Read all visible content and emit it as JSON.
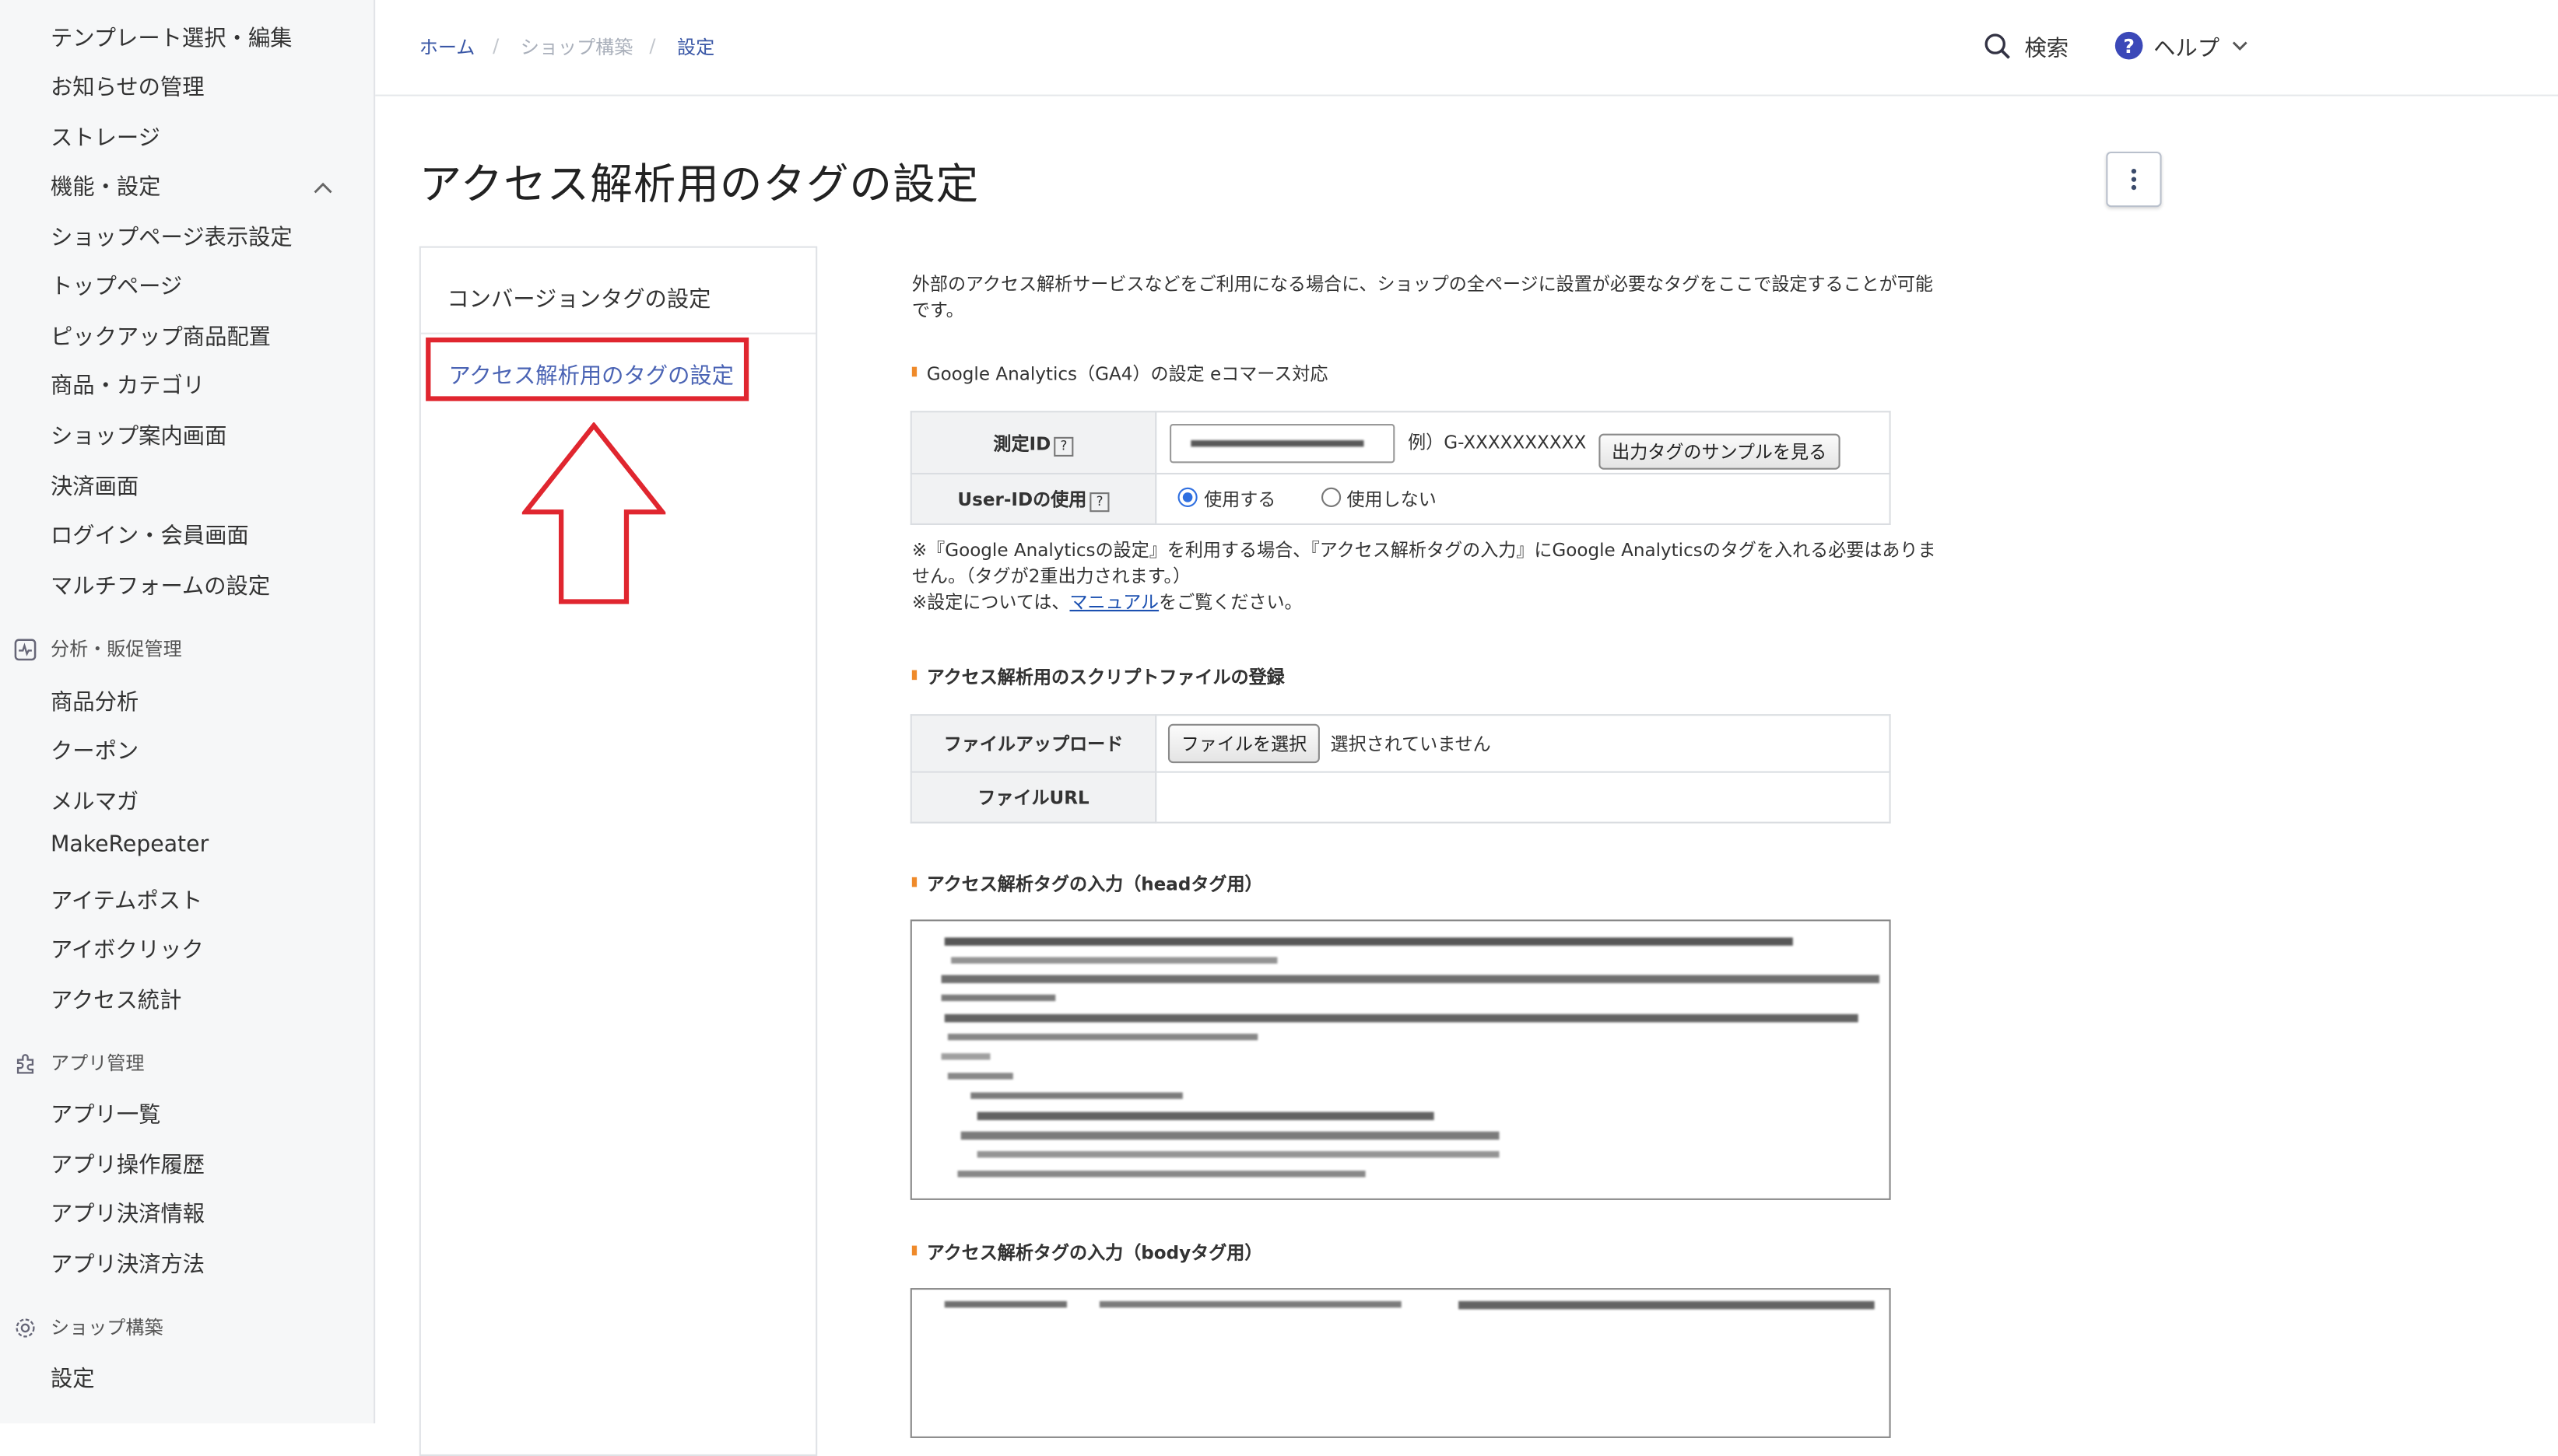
{
  "sidebar": {
    "items_top": [
      "テンプレート選択・編集",
      "お知らせの管理",
      "ストレージ"
    ],
    "group_features": "機能・設定",
    "features_items": [
      "ショップページ表示設定",
      "トップページ",
      "ピックアップ商品配置",
      "商品・カテゴリ",
      "ショップ案内画面",
      "決済画面",
      "ログイン・会員画面",
      "マルチフォームの設定"
    ],
    "section_analytics": "分析・販促管理",
    "analytics_items": [
      "商品分析",
      "クーポン",
      "メルマガ",
      "MakeRepeater",
      "アイテムポスト",
      "アイボクリック",
      "アクセス統計"
    ],
    "section_apps": "アプリ管理",
    "apps_items": [
      "アプリ一覧",
      "アプリ操作履歴",
      "アプリ決済情報",
      "アプリ決済方法"
    ],
    "section_shop": "ショップ構築",
    "shop_items": [
      "設定"
    ]
  },
  "header": {
    "breadcrumb": {
      "home": "ホーム",
      "shop": "ショップ構築",
      "settings": "設定",
      "sep": "/"
    },
    "search_label": "検索",
    "help_label": "ヘルプ"
  },
  "page": {
    "title": "アクセス解析用のタグの設定"
  },
  "subnav": {
    "conversion": "コンバージョンタグの設定",
    "access": "アクセス解析用のタグの設定"
  },
  "main": {
    "intro_line1": "外部のアクセス解析サービスなどをご利用になる場合に、ショップの全ページに設置が必要なタグをここで設定することが可能",
    "intro_line2": "です。",
    "ga_title": "Google Analytics（GA4）の設定 eコマース対応",
    "measurement_id_label": "測定ID",
    "measurement_example": "例）G-XXXXXXXXXX",
    "sample_button": "出力タグのサンプルを見る",
    "userid_label": "User-IDの使用",
    "radio_use": "使用する",
    "radio_nouse": "使用しない",
    "note1": "※『Google Analyticsの設定』を利用する場合、『アクセス解析タグの入力』にGoogle Analyticsのタグを入れる必要はありま",
    "note2": "せん。（タグが2重出力されます。）",
    "note3_pre": "※設定については、",
    "note3_link": "マニュアル",
    "note3_post": "をご覧ください。",
    "script_title": "アクセス解析用のスクリプトファイルの登録",
    "file_upload_label": "ファイルアップロード",
    "file_choose_button": "ファイルを選択",
    "file_none": "選択されていません",
    "file_url_label": "ファイルURL",
    "head_title": "アクセス解析タグの入力（headタグ用）",
    "body_title": "アクセス解析タグの入力（bodyタグ用）",
    "help_q": "?"
  },
  "colors": {
    "accent": "#4a63b4",
    "highlight_border": "#e0262f",
    "section_marker": "#ef8a2a",
    "radio": "#2f6fe0"
  }
}
